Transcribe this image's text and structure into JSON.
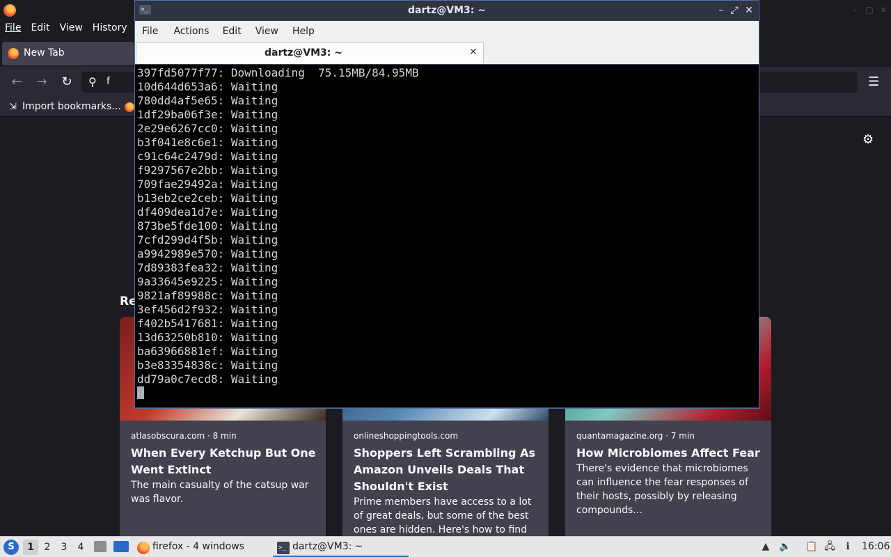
{
  "firefox": {
    "menu": [
      "File",
      "Edit",
      "View",
      "History"
    ],
    "tab_label": "New Tab",
    "url_text": "f",
    "bookmark_label": "Import bookmarks...",
    "section_heading": "Re",
    "cards": [
      {
        "source": "atlasobscura.com · 8 min",
        "title": "When Every Ketchup But One Went Extinct",
        "description": "The main casualty of the catsup war was flavor."
      },
      {
        "source": "onlineshoppingtools.com",
        "title": "Shoppers Left Scrambling As Amazon Unveils Deals That Shouldn't Exist",
        "description": "Prime members have access to a lot of great deals, but some of the best ones are hidden. Here's how to find them."
      },
      {
        "source": "quantamagazine.org · 7 min",
        "title": "How Microbiomes Affect Fear",
        "description": "There's evidence that microbiomes can influence the fear responses of their hosts, possibly by releasing compounds…"
      }
    ]
  },
  "terminal": {
    "title": "dartz@VM3: ~",
    "menu": [
      "File",
      "Actions",
      "Edit",
      "View",
      "Help"
    ],
    "tab_label": "dartz@VM3: ~",
    "lines": [
      "397fd5077f77: Downloading  75.15MB/84.95MB",
      "10d644d653a6: Waiting",
      "780dd4af5e65: Waiting",
      "1df29ba06f3e: Waiting",
      "2e29e6267cc0: Waiting",
      "b3f041e8c6e1: Waiting",
      "c91c64c2479d: Waiting",
      "f9297567e2bb: Waiting",
      "709fae29492a: Waiting",
      "b13eb2ce2ceb: Waiting",
      "df409dea1d7e: Waiting",
      "873be5fde100: Waiting",
      "7cfd299d4f5b: Waiting",
      "a9942989e570: Waiting",
      "7d89383fea32: Waiting",
      "9a33645e9225: Waiting",
      "9821af89988c: Waiting",
      "3ef456d2f932: Waiting",
      "f402b5417681: Waiting",
      "13d63250b810: Waiting",
      "ba63966881ef: Waiting",
      "b3e83354838c: Waiting",
      "dd79a0c7ecd8: Waiting"
    ]
  },
  "taskbar": {
    "workspaces": [
      "1",
      "2",
      "3",
      "4"
    ],
    "active_workspace": "1",
    "tasks": [
      {
        "label": "firefox - 4 windows",
        "icon": "firefox-icon"
      },
      {
        "label": "dartz@VM3: ~",
        "icon": "terminal-icon"
      }
    ],
    "clock": "16:06"
  },
  "colors": {
    "terminal_bg": "#000000",
    "terminal_text": "#d3d7cf",
    "firefox_bg": "#1c1b22",
    "card_bg": "#42414d",
    "accent": "#2a6bc9"
  }
}
